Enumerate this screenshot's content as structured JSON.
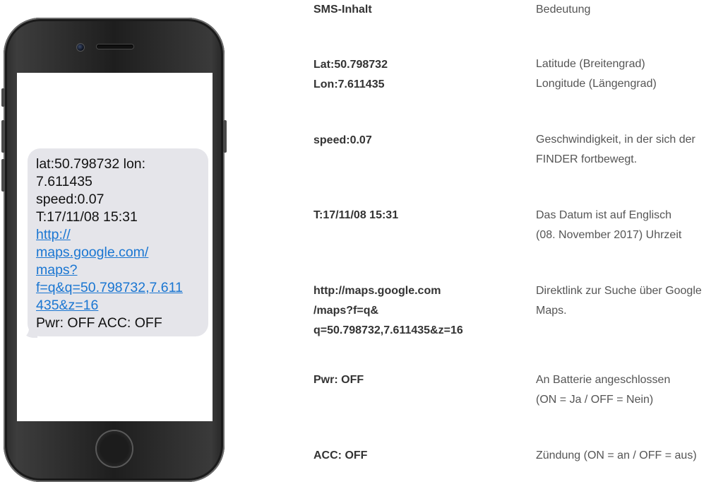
{
  "sms": {
    "lines": [
      "lat:50.798732 lon:",
      "7.611435",
      "speed:0.07",
      "T:17/11/08 15:31"
    ],
    "link_lines": [
      "http://",
      "maps.google.com/",
      "maps?",
      "f=q&q=50.798732,7.611",
      "435&z=16"
    ],
    "last_line": "Pwr: OFF ACC: OFF"
  },
  "table": {
    "header": {
      "left": "SMS-Inhalt",
      "right": "Bedeutung"
    },
    "rows": [
      {
        "left": [
          "Lat:50.798732",
          "Lon:7.611435"
        ],
        "right": [
          "Latitude (Breitengrad)",
          "Longitude (Längengrad)"
        ]
      },
      {
        "left": [
          "speed:0.07"
        ],
        "right": [
          "Geschwindigkeit, in der sich der",
          "FINDER fortbewegt."
        ]
      },
      {
        "left": [
          "T:17/11/08 15:31"
        ],
        "right": [
          "Das Datum ist auf Englisch",
          "(08. November 2017) Uhrzeit"
        ]
      },
      {
        "left": [
          "http://maps.google.com",
          "/maps?f=q&",
          "q=50.798732,7.611435&z=16"
        ],
        "right": [
          "Direktlink zur Suche über Google",
          "Maps."
        ]
      },
      {
        "left": [
          "Pwr: OFF"
        ],
        "right": [
          "An Batterie angeschlossen",
          "(ON = Ja / OFF = Nein)"
        ]
      },
      {
        "left": [
          "ACC: OFF"
        ],
        "right": [
          "Zündung (ON = an / OFF = aus)"
        ]
      }
    ]
  },
  "colors": {
    "bubble": "#e5e5ea",
    "link": "#1a76d2",
    "phone_body": "#2b2b2b"
  }
}
